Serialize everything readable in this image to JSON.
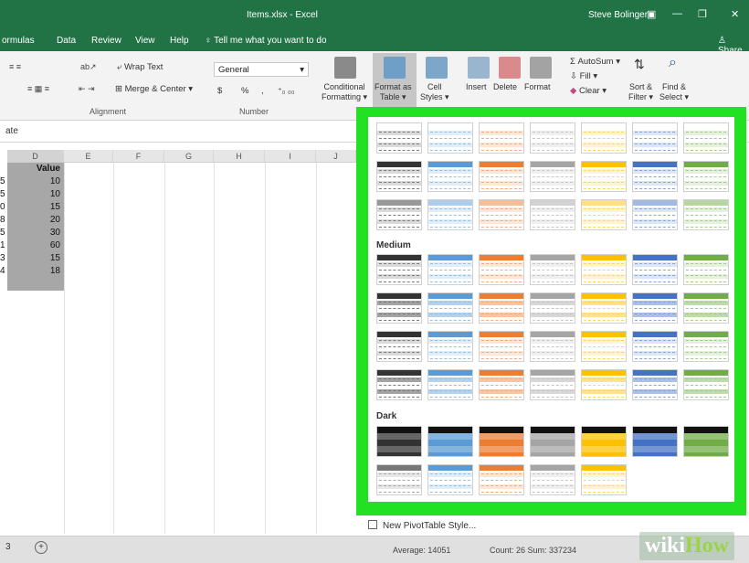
{
  "window": {
    "title": "Items.xlsx - Excel",
    "user": "Steve Bolinger",
    "icons": [
      "ribbon-display-icon",
      "minimize-icon",
      "restore-icon",
      "close-icon"
    ]
  },
  "tabs": {
    "formulas": "ormulas",
    "data": "Data",
    "review": "Review",
    "view": "View",
    "help": "Help",
    "tell_me": "Tell me what you want to do",
    "share": "Share"
  },
  "ribbon": {
    "alignment": {
      "wrap_text": "Wrap Text",
      "merge_center": "Merge & Center",
      "group_label": "Alignment"
    },
    "number": {
      "format_value": "General",
      "currency": "$",
      "percent": "%",
      "comma": ",",
      "group_label": "Number"
    },
    "styles": {
      "conditional_formatting_1": "Conditional",
      "conditional_formatting_2": "Formatting",
      "format_as_table_1": "Format as",
      "format_as_table_2": "Table",
      "cell_styles_1": "Cell",
      "cell_styles_2": "Styles"
    },
    "cells": {
      "insert": "Insert",
      "delete": "Delete",
      "format": "Format"
    },
    "editing": {
      "autosum": "AutoSum",
      "fill": "Fill",
      "clear": "Clear",
      "sort_filter_1": "Sort &",
      "sort_filter_2": "Filter",
      "find_select_1": "Find &",
      "find_select_2": "Select"
    }
  },
  "formula_bar": {
    "name_box": "ate"
  },
  "sheet": {
    "columns": [
      "D",
      "E",
      "F",
      "G",
      "H",
      "I",
      "J"
    ],
    "header_cell": "Value",
    "left_stub": [
      "5",
      "5",
      "0",
      "8",
      "5",
      "1",
      "3",
      "4"
    ],
    "values": [
      "10",
      "10",
      "15",
      "20",
      "30",
      "60",
      "15",
      "18"
    ]
  },
  "gallery": {
    "sections": {
      "medium": "Medium",
      "dark": "Dark"
    },
    "palette": [
      "#333333",
      "#5b9bd5",
      "#ed7d31",
      "#a5a5a5",
      "#ffc000",
      "#4472c4",
      "#70ad47"
    ],
    "new_pivot_style": "New PivotTable Style..."
  },
  "status_bar": {
    "sheet_index": "3",
    "average": "Average: 14051",
    "count_sum": "Count: 26  Sum: 337234"
  },
  "watermark": {
    "wiki": "wiki",
    "how": "How"
  }
}
